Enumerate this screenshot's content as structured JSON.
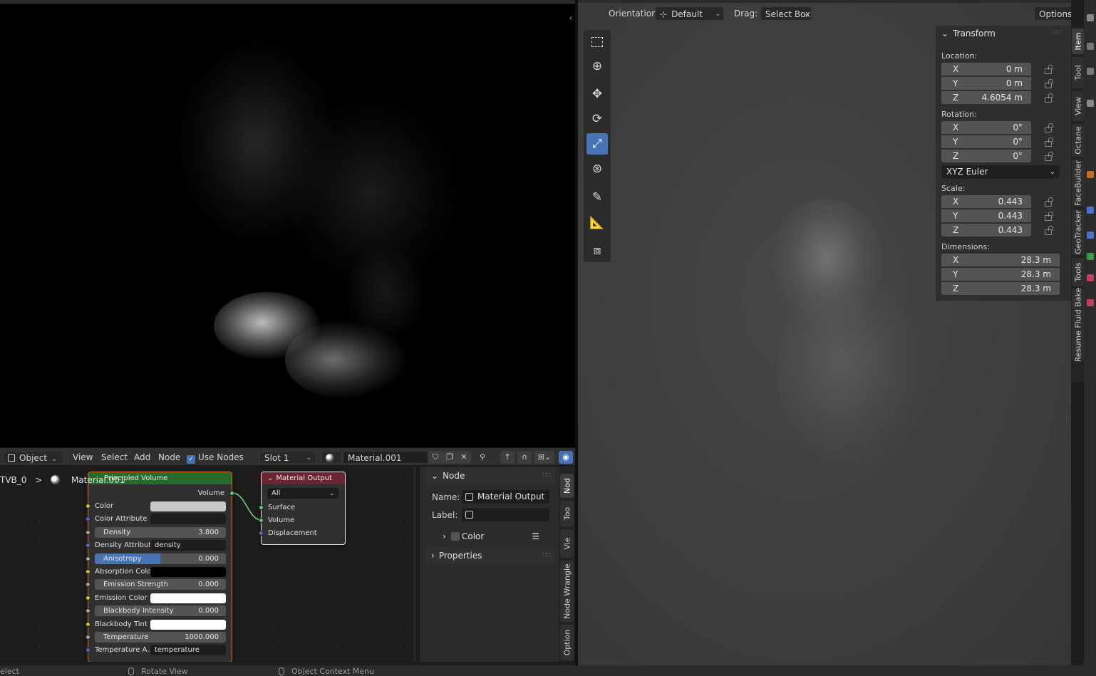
{
  "render_view": {
    "collapse_glyph": "‹"
  },
  "node_header": {
    "mode": "Object",
    "menus": [
      "View",
      "Select",
      "Add",
      "Node"
    ],
    "use_nodes_label": "Use Nodes",
    "slot": "Slot 1",
    "material": "Material.001"
  },
  "breadcrumb": {
    "object": "TVB_0",
    "separator": ">",
    "material": "Material.001"
  },
  "principled_node": {
    "title": "Principled Volume",
    "output": "Volume",
    "rows": [
      {
        "label": "Color",
        "kind": "color",
        "color": "#c8c8c8",
        "socket": "yellow"
      },
      {
        "label": "Color Attribute",
        "kind": "text",
        "value": "",
        "socket": "blue"
      },
      {
        "label": "Density",
        "kind": "slider",
        "value": "3.800",
        "socket": "gray"
      },
      {
        "label": "Density Attribute",
        "kind": "text",
        "value": "density",
        "socket": "blue"
      },
      {
        "label": "Anisotropy",
        "kind": "slider",
        "value": "0.000",
        "socket": "gray",
        "fill": 0.5
      },
      {
        "label": "Absorption Color",
        "kind": "color",
        "color": "#000000",
        "socket": "yellow"
      },
      {
        "label": "Emission Strength",
        "kind": "slider",
        "value": "0.000",
        "socket": "gray"
      },
      {
        "label": "Emission Color",
        "kind": "color",
        "color": "#ffffff",
        "socket": "yellow"
      },
      {
        "label": "Blackbody Intensity",
        "kind": "slider",
        "value": "0.000",
        "socket": "gray"
      },
      {
        "label": "Blackbody Tint",
        "kind": "color",
        "color": "#ffffff",
        "socket": "yellow"
      },
      {
        "label": "Temperature",
        "kind": "slider",
        "value": "1000.000",
        "socket": "gray"
      },
      {
        "label": "Temperature A...",
        "kind": "text",
        "value": "temperature",
        "socket": "blue"
      }
    ]
  },
  "output_node": {
    "title": "Material Output",
    "target": "All",
    "inputs": [
      "Surface",
      "Volume",
      "Displacement"
    ]
  },
  "node_sidebar": {
    "node_panel": "Node",
    "name_label": "Name:",
    "name_value": "Material Output",
    "label_label": "Label:",
    "label_value": "",
    "color_label": "Color",
    "properties_label": "Properties",
    "tabs": [
      "Nod",
      "Too",
      "Vie",
      "Node Wrangle",
      "Option"
    ]
  },
  "status_bar": {
    "left": "elect",
    "middle": "Rotate View",
    "right": "Object Context Menu"
  },
  "viewport": {
    "orientation_label": "Orientation:",
    "orientation_value": "Default",
    "drag_label": "Drag:",
    "drag_value": "Select Box",
    "options_label": "Options",
    "tools": [
      "select-box",
      "cursor",
      "move",
      "rotate",
      "scale",
      "transform",
      "annotate",
      "measure",
      "add-cube"
    ],
    "active_tool": "scale"
  },
  "transform": {
    "title": "Transform",
    "location_label": "Location:",
    "location": [
      {
        "axis": "X",
        "value": "0 m"
      },
      {
        "axis": "Y",
        "value": "0 m"
      },
      {
        "axis": "Z",
        "value": "4.6054 m"
      }
    ],
    "rotation_label": "Rotation:",
    "rotation": [
      {
        "axis": "X",
        "value": "0°"
      },
      {
        "axis": "Y",
        "value": "0°"
      },
      {
        "axis": "Z",
        "value": "0°"
      }
    ],
    "rotation_mode": "XYZ Euler",
    "scale_label": "Scale:",
    "scale": [
      {
        "axis": "X",
        "value": "0.443"
      },
      {
        "axis": "Y",
        "value": "0.443"
      },
      {
        "axis": "Z",
        "value": "0.443"
      }
    ],
    "dimensions_label": "Dimensions:",
    "dimensions": [
      {
        "axis": "X",
        "value": "28.3 m"
      },
      {
        "axis": "Y",
        "value": "28.3 m"
      },
      {
        "axis": "Z",
        "value": "28.3 m"
      }
    ]
  },
  "item_tabs": [
    "Item",
    "Tool",
    "View",
    "Octane",
    "FaceBuilder",
    "GeoTracker",
    "Tools",
    "Resume Fluid Bake"
  ]
}
